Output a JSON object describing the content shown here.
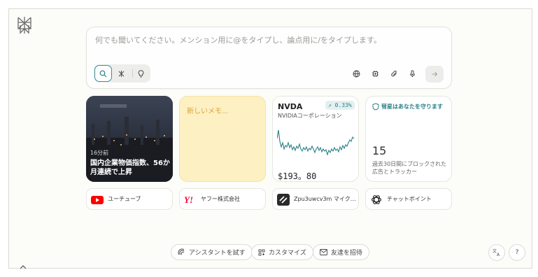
{
  "composer": {
    "placeholder": "何でも聞いてください。メンション用に@をタイプし、論点用に/をタイプします。"
  },
  "cards": {
    "news": {
      "time": "16分前",
      "headline": "国内企業物価指数、56か月連続で上昇"
    },
    "memo": {
      "label": "新しいメモ..."
    },
    "stock": {
      "ticker": "NVDA",
      "name": "NVIDIAコーポレーション",
      "change": "↗ 0.33%",
      "price": "$193。80",
      "accent": "#2a7f86"
    },
    "security": {
      "title": "彗星はあなたを守ります",
      "count": "15",
      "desc": "過去30日間にブロックされた広告とトラッカー"
    }
  },
  "links": [
    {
      "label": "ユーチューブ",
      "icon": "youtube-icon"
    },
    {
      "label": "ヤフー株式会社",
      "icon": "yahoo-icon"
    },
    {
      "label": "Zpu3uwcv3m マイク…",
      "icon": "app-icon"
    },
    {
      "label": "チャットボイント",
      "icon": "chatgpt-icon"
    }
  ],
  "footer": {
    "assistant": "アシスタントを試す",
    "customize": "カスタマイズ",
    "invite": "友達を招待",
    "help": "?"
  }
}
